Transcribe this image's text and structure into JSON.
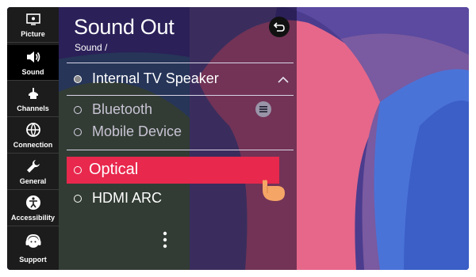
{
  "sidebar": {
    "items": [
      {
        "label": "Picture",
        "icon": "picture-icon",
        "active": false
      },
      {
        "label": "Sound",
        "icon": "speaker-icon",
        "active": true
      },
      {
        "label": "Channels",
        "icon": "antenna-icon",
        "active": false
      },
      {
        "label": "Connection",
        "icon": "connection-icon",
        "active": false
      },
      {
        "label": "General",
        "icon": "wrench-icon",
        "active": false
      },
      {
        "label": "Accessibility",
        "icon": "accessibility-icon",
        "active": false
      },
      {
        "label": "Support",
        "icon": "support-icon",
        "active": false
      }
    ]
  },
  "header": {
    "title": "Sound Out",
    "breadcrumb": "Sound /",
    "back_icon": "back-arrow-icon"
  },
  "options": [
    {
      "label": "Internal TV Speaker",
      "selected": true
    },
    {
      "label": "Bluetooth",
      "selected": false
    },
    {
      "label": "Mobile Device",
      "selected": false
    },
    {
      "label": "Optical",
      "selected": false,
      "focused": true
    },
    {
      "label": "HDMI ARC",
      "selected": false
    }
  ],
  "colors": {
    "accent": "#e8284d",
    "sidebar_bg": "#1c1c1c",
    "panel_overlay": "#120a2c"
  },
  "icons": {
    "expand": "chevron-up-icon",
    "list": "list-icon",
    "more": "more-vertical-icon",
    "pointer": "hand-pointer-icon"
  }
}
